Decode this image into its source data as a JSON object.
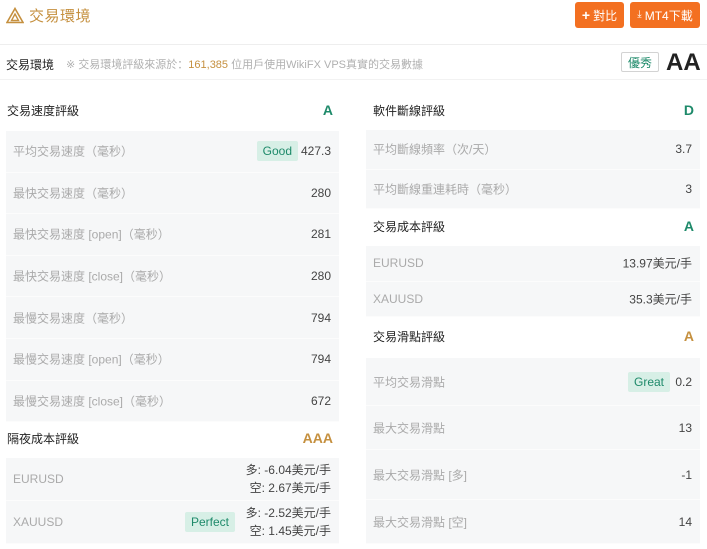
{
  "header": {
    "title": "交易環境",
    "compare_label": "對比",
    "mt4_label": "MT4下載"
  },
  "environment": {
    "label": "交易環境",
    "note_prefix": "※ 交易環境評級來源於：",
    "user_count": "161,385",
    "note_suffix": " 位用戶使用WikiFX VPS真實的交易數據",
    "badge": "優秀",
    "grade": "AA"
  },
  "speed": {
    "title": "交易速度評級",
    "grade": "A",
    "rows": [
      {
        "name": "平均交易速度（毫秒）",
        "tag": "Good",
        "value": "427.3"
      },
      {
        "name": "最快交易速度（毫秒）",
        "value": "280"
      },
      {
        "name": "最快交易速度 [open]（毫秒）",
        "value": "281"
      },
      {
        "name": "最快交易速度 [close]（毫秒）",
        "value": "280"
      },
      {
        "name": "最慢交易速度（毫秒）",
        "value": "794"
      },
      {
        "name": "最慢交易速度 [open]（毫秒）",
        "value": "794"
      },
      {
        "name": "最慢交易速度 [close]（毫秒）",
        "value": "672"
      }
    ]
  },
  "overnight": {
    "title": "隔夜成本評級",
    "grade": "AAA",
    "rows": [
      {
        "name": "EURUSD",
        "long": "多: -6.04美元/手",
        "short": "空: 2.67美元/手"
      },
      {
        "name": "XAUUSD",
        "tag": "Perfect",
        "long": "多: -2.52美元/手",
        "short": "空: 1.45美元/手"
      }
    ]
  },
  "disconnect": {
    "title": "軟件斷線評級",
    "grade": "D",
    "rows": [
      {
        "name": "平均斷線頻率（次/天）",
        "value": "3.7"
      },
      {
        "name": "平均斷線重連耗時（毫秒）",
        "value": "3"
      }
    ]
  },
  "cost": {
    "title": "交易成本評級",
    "grade": "A",
    "rows": [
      {
        "name": "EURUSD",
        "value": "13.97美元/手"
      },
      {
        "name": "XAUUSD",
        "value": "35.3美元/手"
      }
    ]
  },
  "slippage": {
    "title": "交易滑點評級",
    "grade": "A",
    "rows": [
      {
        "name": "平均交易滑點",
        "tag": "Great",
        "value": "0.2"
      },
      {
        "name": "最大交易滑點",
        "value": "13"
      },
      {
        "name": "最大交易滑點 [多]",
        "value": "-1"
      },
      {
        "name": "最大交易滑點 [空]",
        "value": "14"
      }
    ]
  },
  "colors": {
    "accent": "#f37021",
    "gold": "#c5903f",
    "green": "#1e8a6a"
  }
}
